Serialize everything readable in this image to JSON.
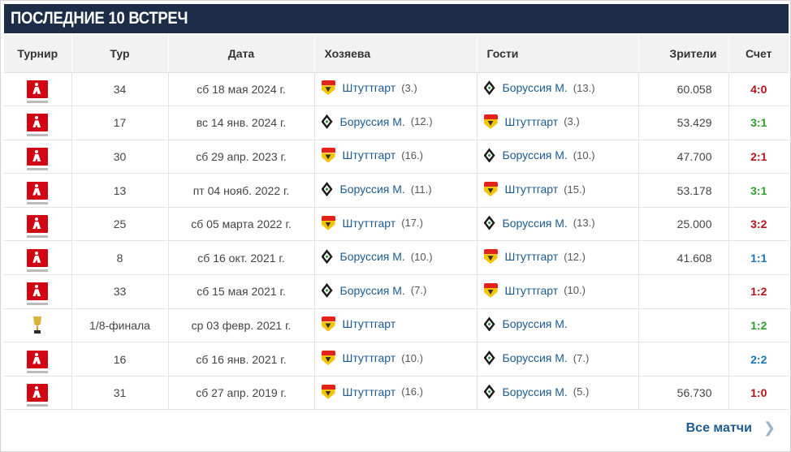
{
  "header": {
    "title": "ПОСЛЕДНИЕ 10 ВСТРЕЧ"
  },
  "columns": {
    "tournament": "Турнир",
    "round": "Тур",
    "date": "Дата",
    "home": "Хозяева",
    "away": "Гости",
    "attendance": "Зрители",
    "score": "Счет"
  },
  "competition_icons": {
    "bundesliga": "bundesliga-logo-icon",
    "cup": "dfb-pokal-trophy-icon"
  },
  "team_icons": {
    "Штуттгарт": "vfb-stuttgart-crest-icon",
    "Боруссия М.": "borussia-monchengladbach-crest-icon"
  },
  "result_colors": {
    "win": "#b5121b",
    "draw": "#1a73b5",
    "loss": "#2e9e2e"
  },
  "matches": [
    {
      "comp": "bundesliga",
      "round": "34",
      "date": "сб 18 мая 2024 г.",
      "home": "Штуттгарт",
      "home_rank": "(3.)",
      "away": "Боруссия М.",
      "away_rank": "(13.)",
      "attendance": "60.058",
      "score": "4:0",
      "result": "win"
    },
    {
      "comp": "bundesliga",
      "round": "17",
      "date": "вс 14 янв. 2024 г.",
      "home": "Боруссия М.",
      "home_rank": "(12.)",
      "away": "Штуттгарт",
      "away_rank": "(3.)",
      "attendance": "53.429",
      "score": "3:1",
      "result": "loss"
    },
    {
      "comp": "bundesliga",
      "round": "30",
      "date": "сб 29 апр. 2023 г.",
      "home": "Штуттгарт",
      "home_rank": "(16.)",
      "away": "Боруссия М.",
      "away_rank": "(10.)",
      "attendance": "47.700",
      "score": "2:1",
      "result": "win"
    },
    {
      "comp": "bundesliga",
      "round": "13",
      "date": "пт 04 нояб. 2022 г.",
      "home": "Боруссия М.",
      "home_rank": "(11.)",
      "away": "Штуттгарт",
      "away_rank": "(15.)",
      "attendance": "53.178",
      "score": "3:1",
      "result": "loss"
    },
    {
      "comp": "bundesliga",
      "round": "25",
      "date": "сб 05 марта 2022 г.",
      "home": "Штуттгарт",
      "home_rank": "(17.)",
      "away": "Боруссия М.",
      "away_rank": "(13.)",
      "attendance": "25.000",
      "score": "3:2",
      "result": "win"
    },
    {
      "comp": "bundesliga",
      "round": "8",
      "date": "сб 16 окт. 2021 г.",
      "home": "Боруссия М.",
      "home_rank": "(10.)",
      "away": "Штуттгарт",
      "away_rank": "(12.)",
      "attendance": "41.608",
      "score": "1:1",
      "result": "draw"
    },
    {
      "comp": "bundesliga",
      "round": "33",
      "date": "сб 15 мая 2021 г.",
      "home": "Боруссия М.",
      "home_rank": "(7.)",
      "away": "Штуттгарт",
      "away_rank": "(10.)",
      "attendance": "",
      "score": "1:2",
      "result": "win"
    },
    {
      "comp": "cup",
      "round": "1/8-финала",
      "date": "ср 03 февр. 2021 г.",
      "home": "Штуттгарт",
      "home_rank": "",
      "away": "Боруссия М.",
      "away_rank": "",
      "attendance": "",
      "score": "1:2",
      "result": "loss"
    },
    {
      "comp": "bundesliga",
      "round": "16",
      "date": "сб 16 янв. 2021 г.",
      "home": "Штуттгарт",
      "home_rank": "(10.)",
      "away": "Боруссия М.",
      "away_rank": "(7.)",
      "attendance": "",
      "score": "2:2",
      "result": "draw"
    },
    {
      "comp": "bundesliga",
      "round": "31",
      "date": "сб 27 апр. 2019 г.",
      "home": "Штуттгарт",
      "home_rank": "(16.)",
      "away": "Боруссия М.",
      "away_rank": "(5.)",
      "attendance": "56.730",
      "score": "1:0",
      "result": "win"
    }
  ],
  "footer": {
    "all_matches_label": "Все матчи",
    "chevron_icon": "chevron-right-icon"
  }
}
